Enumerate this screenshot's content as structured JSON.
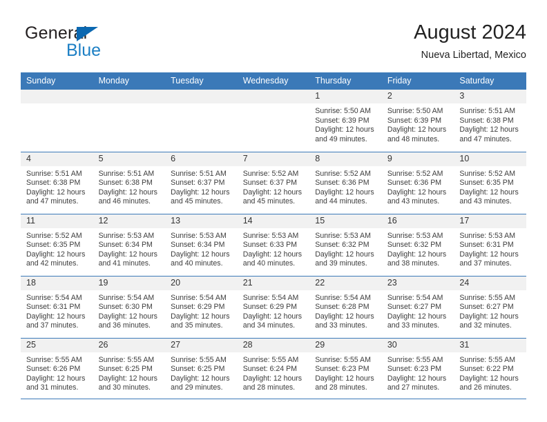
{
  "logo": {
    "word1": "General",
    "word2": "Blue",
    "triangle_color": "#0b68b1",
    "blue_text_color": "#1c7fc4"
  },
  "header": {
    "title": "August 2024",
    "subtitle": "Nueva Libertad, Mexico",
    "header_bg": "#3b79b8",
    "header_text": "#ffffff"
  },
  "weekdays": [
    "Sunday",
    "Monday",
    "Tuesday",
    "Wednesday",
    "Thursday",
    "Friday",
    "Saturday"
  ],
  "weeks": [
    [
      {
        "day": "",
        "sunrise": "",
        "sunset": "",
        "daylight": "",
        "empty": true
      },
      {
        "day": "",
        "sunrise": "",
        "sunset": "",
        "daylight": "",
        "empty": true
      },
      {
        "day": "",
        "sunrise": "",
        "sunset": "",
        "daylight": "",
        "empty": true
      },
      {
        "day": "",
        "sunrise": "",
        "sunset": "",
        "daylight": "",
        "empty": true
      },
      {
        "day": "1",
        "sunrise": "Sunrise: 5:50 AM",
        "sunset": "Sunset: 6:39 PM",
        "daylight": "Daylight: 12 hours and 49 minutes."
      },
      {
        "day": "2",
        "sunrise": "Sunrise: 5:50 AM",
        "sunset": "Sunset: 6:39 PM",
        "daylight": "Daylight: 12 hours and 48 minutes."
      },
      {
        "day": "3",
        "sunrise": "Sunrise: 5:51 AM",
        "sunset": "Sunset: 6:38 PM",
        "daylight": "Daylight: 12 hours and 47 minutes."
      }
    ],
    [
      {
        "day": "4",
        "sunrise": "Sunrise: 5:51 AM",
        "sunset": "Sunset: 6:38 PM",
        "daylight": "Daylight: 12 hours and 47 minutes."
      },
      {
        "day": "5",
        "sunrise": "Sunrise: 5:51 AM",
        "sunset": "Sunset: 6:38 PM",
        "daylight": "Daylight: 12 hours and 46 minutes."
      },
      {
        "day": "6",
        "sunrise": "Sunrise: 5:51 AM",
        "sunset": "Sunset: 6:37 PM",
        "daylight": "Daylight: 12 hours and 45 minutes."
      },
      {
        "day": "7",
        "sunrise": "Sunrise: 5:52 AM",
        "sunset": "Sunset: 6:37 PM",
        "daylight": "Daylight: 12 hours and 45 minutes."
      },
      {
        "day": "8",
        "sunrise": "Sunrise: 5:52 AM",
        "sunset": "Sunset: 6:36 PM",
        "daylight": "Daylight: 12 hours and 44 minutes."
      },
      {
        "day": "9",
        "sunrise": "Sunrise: 5:52 AM",
        "sunset": "Sunset: 6:36 PM",
        "daylight": "Daylight: 12 hours and 43 minutes."
      },
      {
        "day": "10",
        "sunrise": "Sunrise: 5:52 AM",
        "sunset": "Sunset: 6:35 PM",
        "daylight": "Daylight: 12 hours and 43 minutes."
      }
    ],
    [
      {
        "day": "11",
        "sunrise": "Sunrise: 5:52 AM",
        "sunset": "Sunset: 6:35 PM",
        "daylight": "Daylight: 12 hours and 42 minutes."
      },
      {
        "day": "12",
        "sunrise": "Sunrise: 5:53 AM",
        "sunset": "Sunset: 6:34 PM",
        "daylight": "Daylight: 12 hours and 41 minutes."
      },
      {
        "day": "13",
        "sunrise": "Sunrise: 5:53 AM",
        "sunset": "Sunset: 6:34 PM",
        "daylight": "Daylight: 12 hours and 40 minutes."
      },
      {
        "day": "14",
        "sunrise": "Sunrise: 5:53 AM",
        "sunset": "Sunset: 6:33 PM",
        "daylight": "Daylight: 12 hours and 40 minutes."
      },
      {
        "day": "15",
        "sunrise": "Sunrise: 5:53 AM",
        "sunset": "Sunset: 6:32 PM",
        "daylight": "Daylight: 12 hours and 39 minutes."
      },
      {
        "day": "16",
        "sunrise": "Sunrise: 5:53 AM",
        "sunset": "Sunset: 6:32 PM",
        "daylight": "Daylight: 12 hours and 38 minutes."
      },
      {
        "day": "17",
        "sunrise": "Sunrise: 5:53 AM",
        "sunset": "Sunset: 6:31 PM",
        "daylight": "Daylight: 12 hours and 37 minutes."
      }
    ],
    [
      {
        "day": "18",
        "sunrise": "Sunrise: 5:54 AM",
        "sunset": "Sunset: 6:31 PM",
        "daylight": "Daylight: 12 hours and 37 minutes."
      },
      {
        "day": "19",
        "sunrise": "Sunrise: 5:54 AM",
        "sunset": "Sunset: 6:30 PM",
        "daylight": "Daylight: 12 hours and 36 minutes."
      },
      {
        "day": "20",
        "sunrise": "Sunrise: 5:54 AM",
        "sunset": "Sunset: 6:29 PM",
        "daylight": "Daylight: 12 hours and 35 minutes."
      },
      {
        "day": "21",
        "sunrise": "Sunrise: 5:54 AM",
        "sunset": "Sunset: 6:29 PM",
        "daylight": "Daylight: 12 hours and 34 minutes."
      },
      {
        "day": "22",
        "sunrise": "Sunrise: 5:54 AM",
        "sunset": "Sunset: 6:28 PM",
        "daylight": "Daylight: 12 hours and 33 minutes."
      },
      {
        "day": "23",
        "sunrise": "Sunrise: 5:54 AM",
        "sunset": "Sunset: 6:27 PM",
        "daylight": "Daylight: 12 hours and 33 minutes."
      },
      {
        "day": "24",
        "sunrise": "Sunrise: 5:55 AM",
        "sunset": "Sunset: 6:27 PM",
        "daylight": "Daylight: 12 hours and 32 minutes."
      }
    ],
    [
      {
        "day": "25",
        "sunrise": "Sunrise: 5:55 AM",
        "sunset": "Sunset: 6:26 PM",
        "daylight": "Daylight: 12 hours and 31 minutes."
      },
      {
        "day": "26",
        "sunrise": "Sunrise: 5:55 AM",
        "sunset": "Sunset: 6:25 PM",
        "daylight": "Daylight: 12 hours and 30 minutes."
      },
      {
        "day": "27",
        "sunrise": "Sunrise: 5:55 AM",
        "sunset": "Sunset: 6:25 PM",
        "daylight": "Daylight: 12 hours and 29 minutes."
      },
      {
        "day": "28",
        "sunrise": "Sunrise: 5:55 AM",
        "sunset": "Sunset: 6:24 PM",
        "daylight": "Daylight: 12 hours and 28 minutes."
      },
      {
        "day": "29",
        "sunrise": "Sunrise: 5:55 AM",
        "sunset": "Sunset: 6:23 PM",
        "daylight": "Daylight: 12 hours and 28 minutes."
      },
      {
        "day": "30",
        "sunrise": "Sunrise: 5:55 AM",
        "sunset": "Sunset: 6:23 PM",
        "daylight": "Daylight: 12 hours and 27 minutes."
      },
      {
        "day": "31",
        "sunrise": "Sunrise: 5:55 AM",
        "sunset": "Sunset: 6:22 PM",
        "daylight": "Daylight: 12 hours and 26 minutes."
      }
    ]
  ]
}
